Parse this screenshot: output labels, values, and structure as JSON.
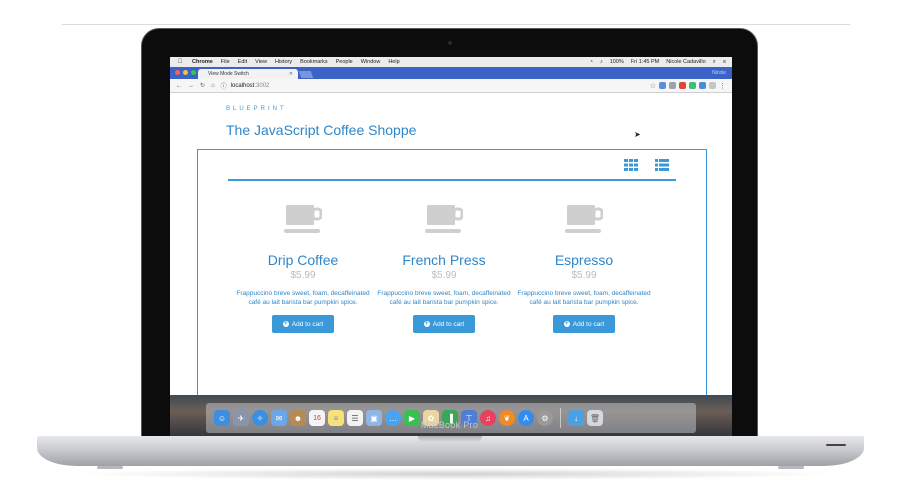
{
  "menubar": {
    "app": "Chrome",
    "items": [
      "File",
      "Edit",
      "View",
      "History",
      "Bookmarks",
      "People",
      "Window",
      "Help"
    ],
    "battery": "100%",
    "clock": "Fri 1:45 PM",
    "user": "Nicole Cadavillo"
  },
  "browser": {
    "tab_title": "View Mode Switch",
    "url_host": "localhost",
    "url_port": ":3002",
    "profile": "Nicole"
  },
  "page": {
    "kicker": "BLUEPRINT",
    "title": "The JavaScript Coffee Shoppe",
    "view_modes": [
      "grid",
      "list"
    ],
    "products": [
      {
        "name": "Drip Coffee",
        "price": "$5.99",
        "description": "Frappuccino breve sweet, foam, decaffeinated café au lait barista bar pumpkin spice.",
        "button": "Add to cart"
      },
      {
        "name": "French Press",
        "price": "$5.99",
        "description": "Frappuccino breve sweet, foam, decaffeinated café au lait barista bar pumpkin spice.",
        "button": "Add to cart"
      },
      {
        "name": "Espresso",
        "price": "$5.99",
        "description": "Frappuccino breve sweet, foam, decaffeinated café au lait barista bar pumpkin spice.",
        "button": "Add to cart"
      }
    ]
  },
  "device": {
    "label": "MacBook Pro"
  },
  "colors": {
    "accent": "#3a9ad9",
    "title": "#2f86c8",
    "price": "#bcbcbc",
    "cup_icon": "#cfcfcf"
  },
  "dock_icons": [
    "finder-icon",
    "launchpad-icon",
    "safari-icon",
    "mail-icon",
    "contacts-icon",
    "calendar-icon",
    "notes-icon",
    "reminders-icon",
    "preview-icon",
    "messages-icon",
    "facetime-icon",
    "photos-icon",
    "numbers-icon",
    "keynote-icon",
    "itunes-icon",
    "ibooks-icon",
    "appstore-icon",
    "system-preferences-icon",
    "downloads-icon",
    "trash-icon"
  ]
}
